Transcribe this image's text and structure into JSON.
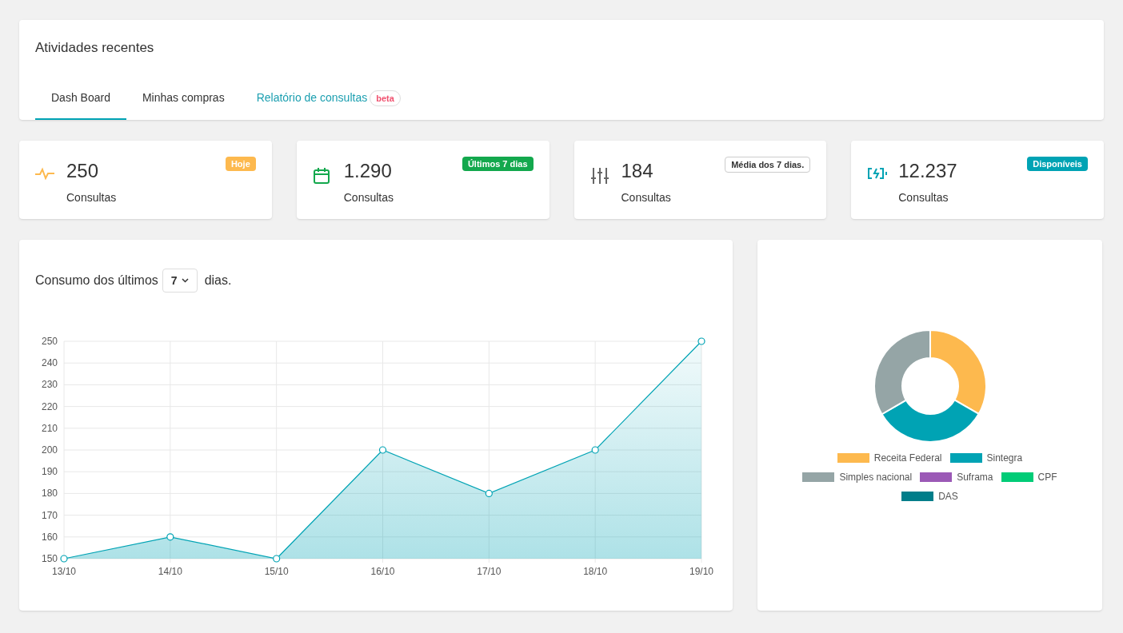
{
  "header": {
    "title": "Atividades recentes",
    "tabs": [
      {
        "label": "Dash Board",
        "selected": true
      },
      {
        "label": "Minhas compras",
        "selected": false
      },
      {
        "label": "Relatório de consultas",
        "selected": false,
        "badge": "beta"
      }
    ]
  },
  "stats": [
    {
      "kind": "pulse",
      "value": "250",
      "label": "Consultas",
      "badge": "Hoje",
      "color": "#fdb94e",
      "outlined": false
    },
    {
      "kind": "calendar",
      "value": "1.290",
      "label": "Consultas",
      "badge": "Últimos 7 dias",
      "color": "#13a84d",
      "outlined": false
    },
    {
      "kind": "sliders",
      "value": "184",
      "label": "Consultas",
      "badge": "Média dos 7 dias.",
      "color": "#666666",
      "outlined": true
    },
    {
      "kind": "battery",
      "value": "12.237",
      "label": "Consultas",
      "badge": "Disponíveis",
      "color": "#00a3b4",
      "outlined": false
    }
  ],
  "consumption": {
    "title_before": "Consumo dos últimos",
    "select_value": "7",
    "title_after": "dias.",
    "chart_data": {
      "type": "area",
      "categories": [
        "13/10",
        "14/10",
        "15/10",
        "16/10",
        "17/10",
        "18/10",
        "19/10"
      ],
      "series": [
        {
          "color": "#00a3b4",
          "values": [
            150,
            160,
            150,
            200,
            180,
            200,
            250
          ]
        }
      ],
      "ylim": [
        150,
        250
      ],
      "yticks": [
        150,
        160,
        170,
        180,
        190,
        200,
        210,
        220,
        230,
        240,
        250
      ],
      "grid": true
    }
  },
  "services": {
    "chart_data": {
      "type": "donut",
      "categories": [
        "Receita Federal",
        "Sintegra",
        "Simples nacional",
        "Suframa",
        "CPF",
        "DAS"
      ],
      "values": [
        33.3,
        33.3,
        33.4,
        0,
        0,
        0
      ],
      "colors": [
        "#fdb94e",
        "#00a3b4",
        "#95a5a6",
        "#9b59b6",
        "#00cc77",
        "#007e8a"
      ],
      "legend": true
    }
  }
}
